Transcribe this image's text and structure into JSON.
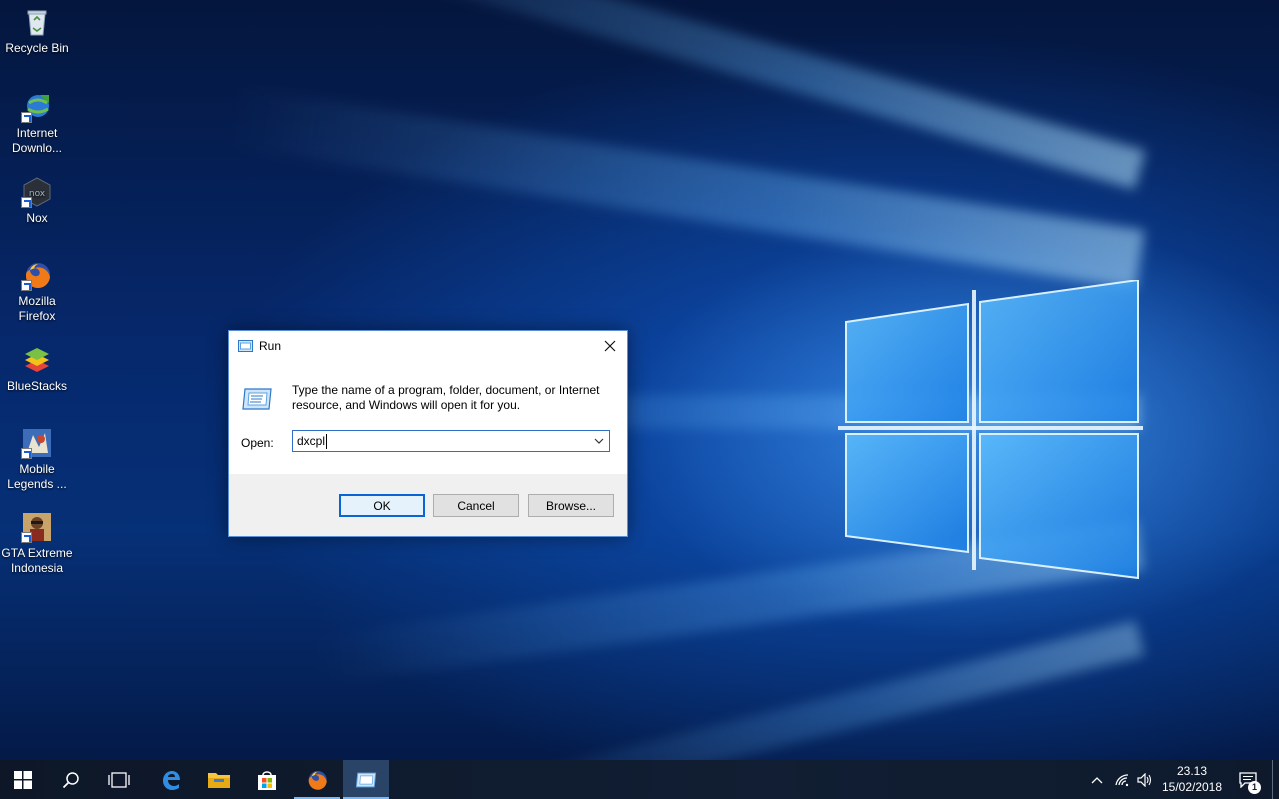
{
  "desktop_icons": [
    {
      "label": "Recycle Bin",
      "icon": "recycle-bin-icon"
    },
    {
      "label": "Internet Downlo...",
      "icon": "internet-download-manager-icon"
    },
    {
      "label": "Nox",
      "icon": "nox-icon"
    },
    {
      "label": "Mozilla Firefox",
      "icon": "firefox-icon"
    },
    {
      "label": "BlueStacks",
      "icon": "bluestacks-icon"
    },
    {
      "label": "Mobile Legends ...",
      "icon": "mobile-legends-icon"
    },
    {
      "label": "GTA Extreme Indonesia",
      "icon": "gta-extreme-icon"
    }
  ],
  "run_dialog": {
    "title": "Run",
    "description": "Type the name of a program, folder, document, or Internet resource, and Windows will open it for you.",
    "open_label": "Open:",
    "open_value": "dxcpl",
    "ok_label": "OK",
    "cancel_label": "Cancel",
    "browse_label": "Browse..."
  },
  "taskbar": {
    "items": [
      "start-icon",
      "search-icon",
      "task-view-icon",
      "edge-icon",
      "file-explorer-icon",
      "store-icon",
      "firefox-icon",
      "run-icon"
    ],
    "clock_time": "23.13",
    "clock_date": "15/02/2018",
    "notification_count": "1"
  },
  "colors": {
    "accent": "#0a64d6",
    "taskbar": "#0f1b2e",
    "dialog_footer": "#f0f0f0"
  }
}
